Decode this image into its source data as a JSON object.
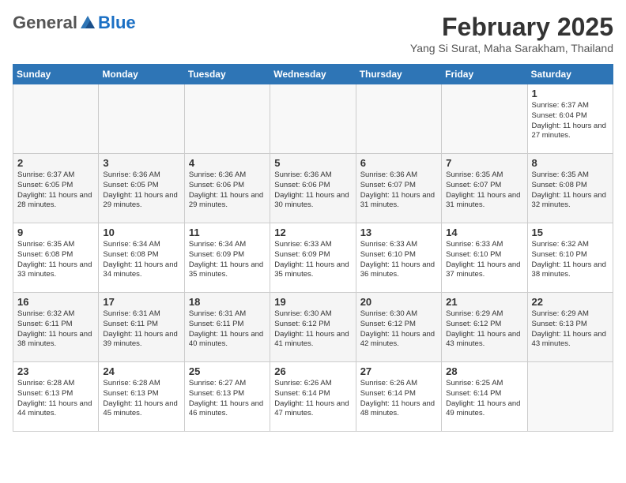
{
  "header": {
    "logo": {
      "general": "General",
      "blue": "Blue",
      "tagline": ""
    },
    "title": "February 2025",
    "location": "Yang Si Surat, Maha Sarakham, Thailand"
  },
  "weekdays": [
    "Sunday",
    "Monday",
    "Tuesday",
    "Wednesday",
    "Thursday",
    "Friday",
    "Saturday"
  ],
  "weeks": [
    [
      {
        "day": "",
        "info": ""
      },
      {
        "day": "",
        "info": ""
      },
      {
        "day": "",
        "info": ""
      },
      {
        "day": "",
        "info": ""
      },
      {
        "day": "",
        "info": ""
      },
      {
        "day": "",
        "info": ""
      },
      {
        "day": "1",
        "info": "Sunrise: 6:37 AM\nSunset: 6:04 PM\nDaylight: 11 hours and 27 minutes."
      }
    ],
    [
      {
        "day": "2",
        "info": "Sunrise: 6:37 AM\nSunset: 6:05 PM\nDaylight: 11 hours and 28 minutes."
      },
      {
        "day": "3",
        "info": "Sunrise: 6:36 AM\nSunset: 6:05 PM\nDaylight: 11 hours and 29 minutes."
      },
      {
        "day": "4",
        "info": "Sunrise: 6:36 AM\nSunset: 6:06 PM\nDaylight: 11 hours and 29 minutes."
      },
      {
        "day": "5",
        "info": "Sunrise: 6:36 AM\nSunset: 6:06 PM\nDaylight: 11 hours and 30 minutes."
      },
      {
        "day": "6",
        "info": "Sunrise: 6:36 AM\nSunset: 6:07 PM\nDaylight: 11 hours and 31 minutes."
      },
      {
        "day": "7",
        "info": "Sunrise: 6:35 AM\nSunset: 6:07 PM\nDaylight: 11 hours and 31 minutes."
      },
      {
        "day": "8",
        "info": "Sunrise: 6:35 AM\nSunset: 6:08 PM\nDaylight: 11 hours and 32 minutes."
      }
    ],
    [
      {
        "day": "9",
        "info": "Sunrise: 6:35 AM\nSunset: 6:08 PM\nDaylight: 11 hours and 33 minutes."
      },
      {
        "day": "10",
        "info": "Sunrise: 6:34 AM\nSunset: 6:08 PM\nDaylight: 11 hours and 34 minutes."
      },
      {
        "day": "11",
        "info": "Sunrise: 6:34 AM\nSunset: 6:09 PM\nDaylight: 11 hours and 35 minutes."
      },
      {
        "day": "12",
        "info": "Sunrise: 6:33 AM\nSunset: 6:09 PM\nDaylight: 11 hours and 35 minutes."
      },
      {
        "day": "13",
        "info": "Sunrise: 6:33 AM\nSunset: 6:10 PM\nDaylight: 11 hours and 36 minutes."
      },
      {
        "day": "14",
        "info": "Sunrise: 6:33 AM\nSunset: 6:10 PM\nDaylight: 11 hours and 37 minutes."
      },
      {
        "day": "15",
        "info": "Sunrise: 6:32 AM\nSunset: 6:10 PM\nDaylight: 11 hours and 38 minutes."
      }
    ],
    [
      {
        "day": "16",
        "info": "Sunrise: 6:32 AM\nSunset: 6:11 PM\nDaylight: 11 hours and 38 minutes."
      },
      {
        "day": "17",
        "info": "Sunrise: 6:31 AM\nSunset: 6:11 PM\nDaylight: 11 hours and 39 minutes."
      },
      {
        "day": "18",
        "info": "Sunrise: 6:31 AM\nSunset: 6:11 PM\nDaylight: 11 hours and 40 minutes."
      },
      {
        "day": "19",
        "info": "Sunrise: 6:30 AM\nSunset: 6:12 PM\nDaylight: 11 hours and 41 minutes."
      },
      {
        "day": "20",
        "info": "Sunrise: 6:30 AM\nSunset: 6:12 PM\nDaylight: 11 hours and 42 minutes."
      },
      {
        "day": "21",
        "info": "Sunrise: 6:29 AM\nSunset: 6:12 PM\nDaylight: 11 hours and 43 minutes."
      },
      {
        "day": "22",
        "info": "Sunrise: 6:29 AM\nSunset: 6:13 PM\nDaylight: 11 hours and 43 minutes."
      }
    ],
    [
      {
        "day": "23",
        "info": "Sunrise: 6:28 AM\nSunset: 6:13 PM\nDaylight: 11 hours and 44 minutes."
      },
      {
        "day": "24",
        "info": "Sunrise: 6:28 AM\nSunset: 6:13 PM\nDaylight: 11 hours and 45 minutes."
      },
      {
        "day": "25",
        "info": "Sunrise: 6:27 AM\nSunset: 6:13 PM\nDaylight: 11 hours and 46 minutes."
      },
      {
        "day": "26",
        "info": "Sunrise: 6:26 AM\nSunset: 6:14 PM\nDaylight: 11 hours and 47 minutes."
      },
      {
        "day": "27",
        "info": "Sunrise: 6:26 AM\nSunset: 6:14 PM\nDaylight: 11 hours and 48 minutes."
      },
      {
        "day": "28",
        "info": "Sunrise: 6:25 AM\nSunset: 6:14 PM\nDaylight: 11 hours and 49 minutes."
      },
      {
        "day": "",
        "info": ""
      }
    ]
  ]
}
